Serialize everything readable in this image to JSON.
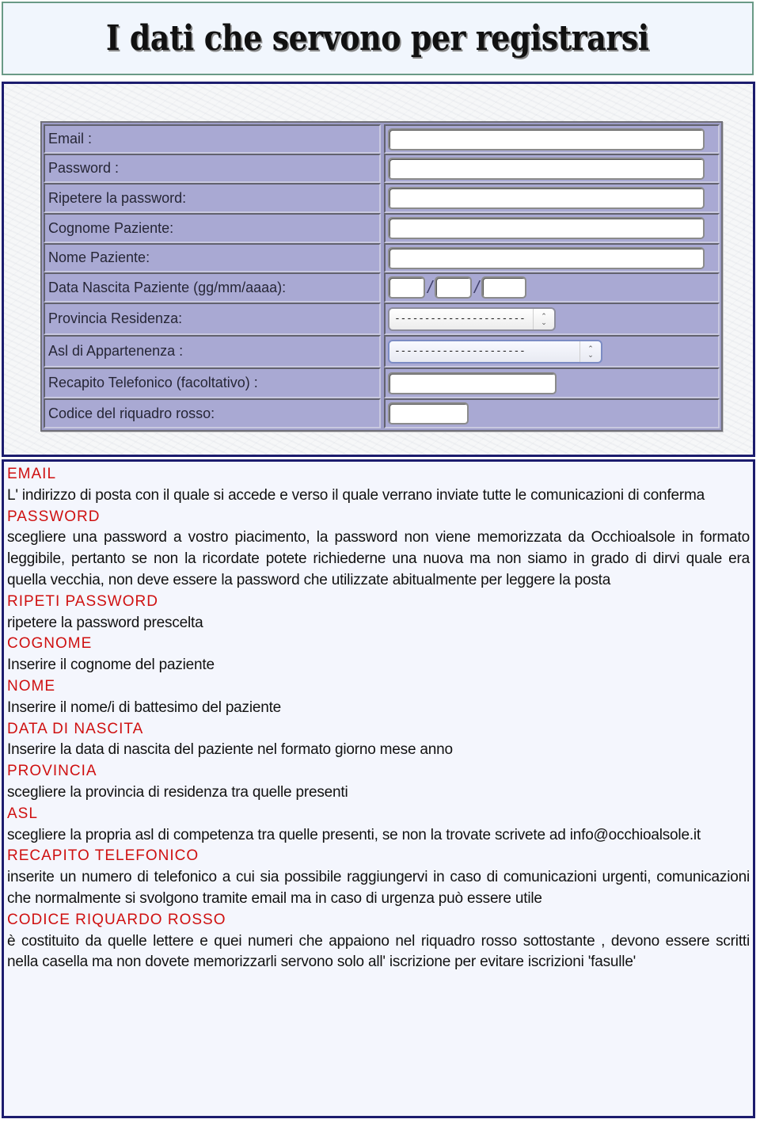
{
  "title": "I dati che servono per registrarsi",
  "colors": {
    "heading_red": "#cf1010",
    "form_background": "#a9a9d3",
    "frame_border": "#1c1c6e",
    "title_border": "#6a9a86"
  },
  "form": {
    "rows": [
      {
        "label": "Email :",
        "type": "text",
        "value": ""
      },
      {
        "label": "Password :",
        "type": "password",
        "value": ""
      },
      {
        "label": "Ripetere la password:",
        "type": "password",
        "value": ""
      },
      {
        "label": "Cognome Paziente:",
        "type": "text",
        "value": ""
      },
      {
        "label": "Nome Paziente:",
        "type": "text",
        "value": ""
      },
      {
        "label": "Data Nascita Paziente (gg/mm/aaaa):",
        "type": "date",
        "day": "",
        "month": "",
        "year": "",
        "separator": "/"
      },
      {
        "label": "Provincia Residenza:",
        "type": "select",
        "selected": "----------------------",
        "icon": "updown-chevron-icon"
      },
      {
        "label": "Asl di Appartenenza :",
        "type": "select",
        "selected": "----------------------",
        "icon": "updown-chevron-icon"
      },
      {
        "label": "Recapito Telefonico (facoltativo) :",
        "type": "text",
        "value": ""
      },
      {
        "label": "Codice del riquadro rosso:",
        "type": "text",
        "value": ""
      }
    ]
  },
  "descriptions": [
    {
      "heading": "EMAIL",
      "text": "L' indirizzo di posta con il quale si accede e verso il quale verrano inviate tutte le comunicazioni di conferma"
    },
    {
      "heading": "PASSWORD",
      "text": "scegliere una password a vostro piacimento, la password non viene memorizzata da Occhioalsole in formato leggibile, pertanto se non la ricordate potete richiederne una nuova ma non siamo in grado di dirvi quale era quella vecchia, non deve essere la password che utilizzate abitualmente per leggere la posta"
    },
    {
      "heading": "RIPETI PASSWORD",
      "text": "ripetere la password prescelta"
    },
    {
      "heading": "COGNOME",
      "text": "Inserire il cognome del paziente"
    },
    {
      "heading": "NOME",
      "text": "Inserire il nome/i di battesimo del paziente"
    },
    {
      "heading": "DATA DI NASCITA",
      "text": "Inserire la data di nascita del paziente nel formato giorno mese anno"
    },
    {
      "heading": "PROVINCIA",
      "text": "scegliere la provincia di residenza tra quelle presenti"
    },
    {
      "heading": "ASL",
      "text": "scegliere la propria asl di competenza tra quelle presenti, se non la trovate scrivete ad info@occhioalsole.it"
    },
    {
      "heading": "RECAPITO TELEFONICO",
      "text": "inserite un numero di telefonico a cui sia possibile raggiungervi in caso di comunicazioni urgenti, comunicazioni che normalmente si svolgono tramite email ma in caso di urgenza può essere utile"
    },
    {
      "heading": "CODICE RIQUARDO ROSSO",
      "text": "è costituito da quelle lettere e quei numeri che appaiono nel riquadro rosso sottostante , devono essere scritti nella casella ma non dovete memorizzarli servono solo all' iscrizione per evitare iscrizioni 'fasulle'"
    }
  ]
}
